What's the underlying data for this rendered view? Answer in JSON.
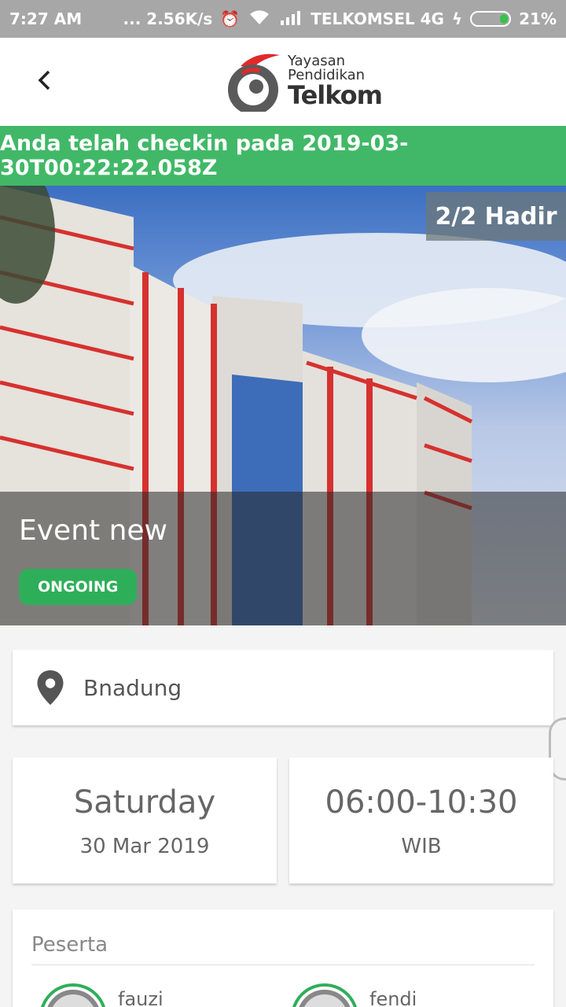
{
  "status_bar": {
    "time": "7:27 AM",
    "speed": "... 2.56K/s",
    "carrier": "TELKOMSEL 4G",
    "battery": "21%"
  },
  "header": {
    "logo_line1": "Yayasan",
    "logo_line2": "Pendidikan",
    "logo_line3": "Telkom"
  },
  "checkin_banner": "Anda telah checkin pada 2019-03-30T00:22:22.058Z",
  "event": {
    "attendance": "2/2 Hadir",
    "title": "Event new",
    "status": "ONGOING"
  },
  "location": "Bnadung",
  "date_card": {
    "day": "Saturday",
    "date": "30 Mar 2019"
  },
  "time_card": {
    "range": "06:00-10:30",
    "zone": "WIB"
  },
  "participants": {
    "title": "Peserta",
    "items": [
      {
        "name": "fauzi"
      },
      {
        "name": "fendi"
      }
    ]
  },
  "colors": {
    "accent_green": "#41b867",
    "status_bar": "#a7a7a7"
  }
}
